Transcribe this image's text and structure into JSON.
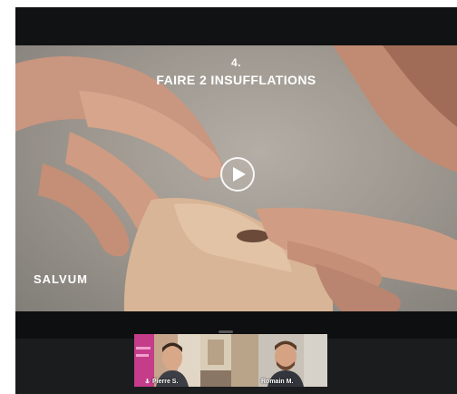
{
  "video": {
    "step_number": "4.",
    "title": "FAIRE 2 INSUFFLATIONS",
    "brand": "SALVUM"
  },
  "participants": [
    {
      "name": "Pierre S."
    },
    {
      "name": "Romain M."
    }
  ],
  "icons": {
    "play": "play-icon",
    "microphone": "microphone-icon",
    "mic_muted": "mic-muted-icon"
  }
}
